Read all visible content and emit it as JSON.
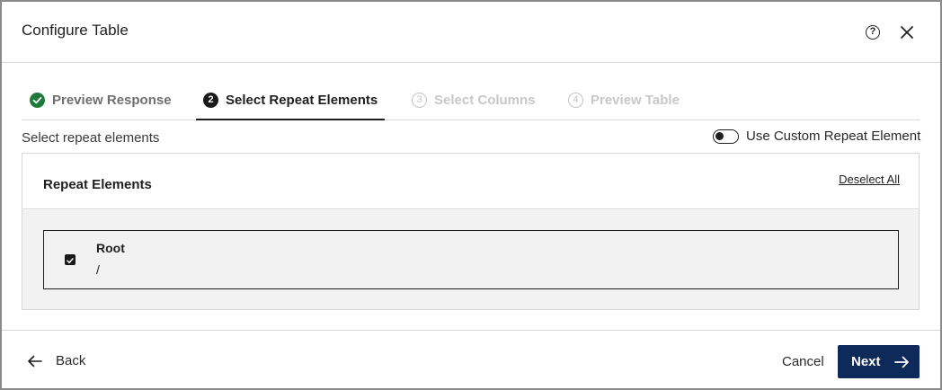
{
  "dialog": {
    "title": "Configure Table",
    "help_icon": "help-circle-icon",
    "close_icon": "close-icon"
  },
  "stepper": {
    "steps": [
      {
        "number": "",
        "label": "Preview Response",
        "state": "complete",
        "icon": "check-circle-icon"
      },
      {
        "number": "2",
        "label": "Select Repeat Elements",
        "state": "active"
      },
      {
        "number": "3",
        "label": "Select Columns",
        "state": "disabled"
      },
      {
        "number": "4",
        "label": "Preview Table",
        "state": "disabled"
      }
    ]
  },
  "content": {
    "subtitle": "Select repeat elements",
    "custom_toggle_label": "Use Custom Repeat Element",
    "custom_toggle_on": false
  },
  "panel": {
    "title": "Repeat Elements",
    "deselect_all": "Deselect All",
    "items": [
      {
        "name": "Root",
        "path": "/",
        "checked": true
      }
    ]
  },
  "footer": {
    "back_label": "Back",
    "cancel_label": "Cancel",
    "next_label": "Next"
  },
  "colors": {
    "primary": "#0e2a5b",
    "success": "#1e7a3a",
    "panel_bg": "#f2f2f2"
  }
}
